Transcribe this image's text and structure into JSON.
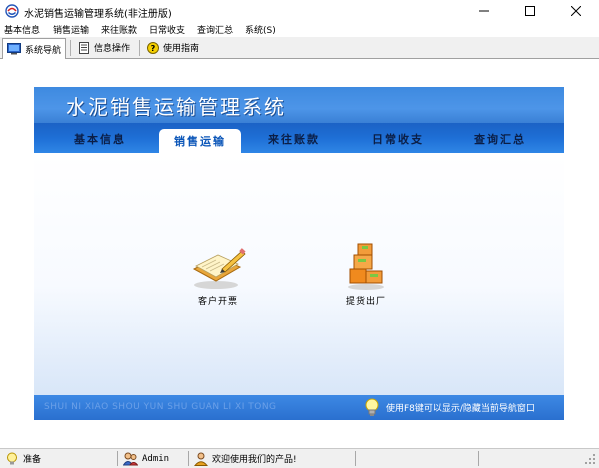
{
  "window": {
    "title": "水泥销售运输管理系统(非注册版)",
    "controls": {
      "minimize": "—",
      "maximize": "☐",
      "close": "✕"
    }
  },
  "menu": [
    "基本信息",
    "销售运输",
    "来往账款",
    "日常收支",
    "查询汇总",
    "系统(S)"
  ],
  "toolbar": {
    "tabs": [
      {
        "label": "系统导航",
        "icon": "monitor-icon",
        "active": true
      },
      {
        "label": "信息操作",
        "icon": "document-icon",
        "active": false
      },
      {
        "label": "使用指南",
        "icon": "help-icon",
        "active": false
      }
    ]
  },
  "main": {
    "banner_title": "水泥销售运输管理系统",
    "nav_tabs": [
      "基本信息",
      "销售运输",
      "来往账款",
      "日常收支",
      "查询汇总"
    ],
    "active_tab": "销售运输",
    "tiles": [
      {
        "label": "客户开票",
        "icon": "notebook-pencil-icon"
      },
      {
        "label": "提货出厂",
        "icon": "boxes-icon"
      }
    ],
    "footer_pinyin": "SHUI NI XIAO SHOU YUN SHU GUAN LI XI TONG",
    "footer_hint": "使用F8键可以显示/隐藏当前导航窗口"
  },
  "status": {
    "ready": "准备",
    "user": "Admin",
    "welcome": "欢迎使用我们的产品!"
  },
  "colors": {
    "banner_blue": "#4d95e8",
    "tab_blue": "#1e6fd6",
    "active_tab_text": "#0a55b8"
  }
}
